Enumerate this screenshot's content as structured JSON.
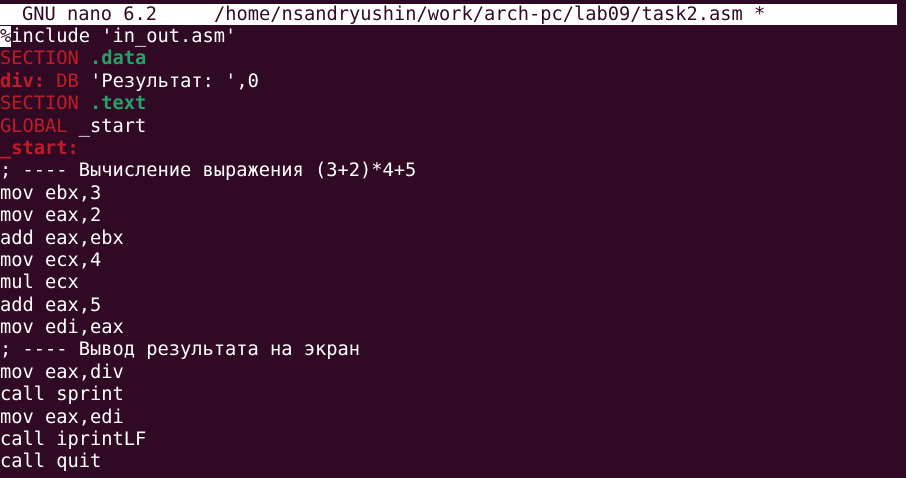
{
  "titlebar": {
    "app_version": "GNU nano 6.2",
    "file_path": "/home/nsandryushin/work/arch-pc/lab09/task2.asm *"
  },
  "editor": {
    "line01_cursor": "%",
    "line01_rest": "include 'in_out.asm'",
    "line02_kw": "SECTION",
    "line02_sec": ".data",
    "line03_label": "div:",
    "line03_kw": "DB",
    "line03_rest": "'Результат: ',0",
    "line04_kw": "SECTION",
    "line04_sec": ".text",
    "line05_kw": "GLOBAL",
    "line05_rest": "_start",
    "line06_label": "_start:",
    "line07": "; ---- Вычисление выражения (3+2)*4+5",
    "line08": "mov ebx,3",
    "line09": "mov eax,2",
    "line10": "add eax,ebx",
    "line11": "mov ecx,4",
    "line12": "mul ecx",
    "line13": "add eax,5",
    "line14": "mov edi,eax",
    "line15": "; ---- Вывод результата на экран",
    "line16": "mov eax,div",
    "line17": "call sprint",
    "line18": "mov eax,edi",
    "line19": "call iprintLF",
    "line20": "call quit"
  },
  "colors": {
    "background": "#300a24",
    "keyword_red": "#c01c28",
    "section_green": "#26a269",
    "text": "#ffffff"
  }
}
